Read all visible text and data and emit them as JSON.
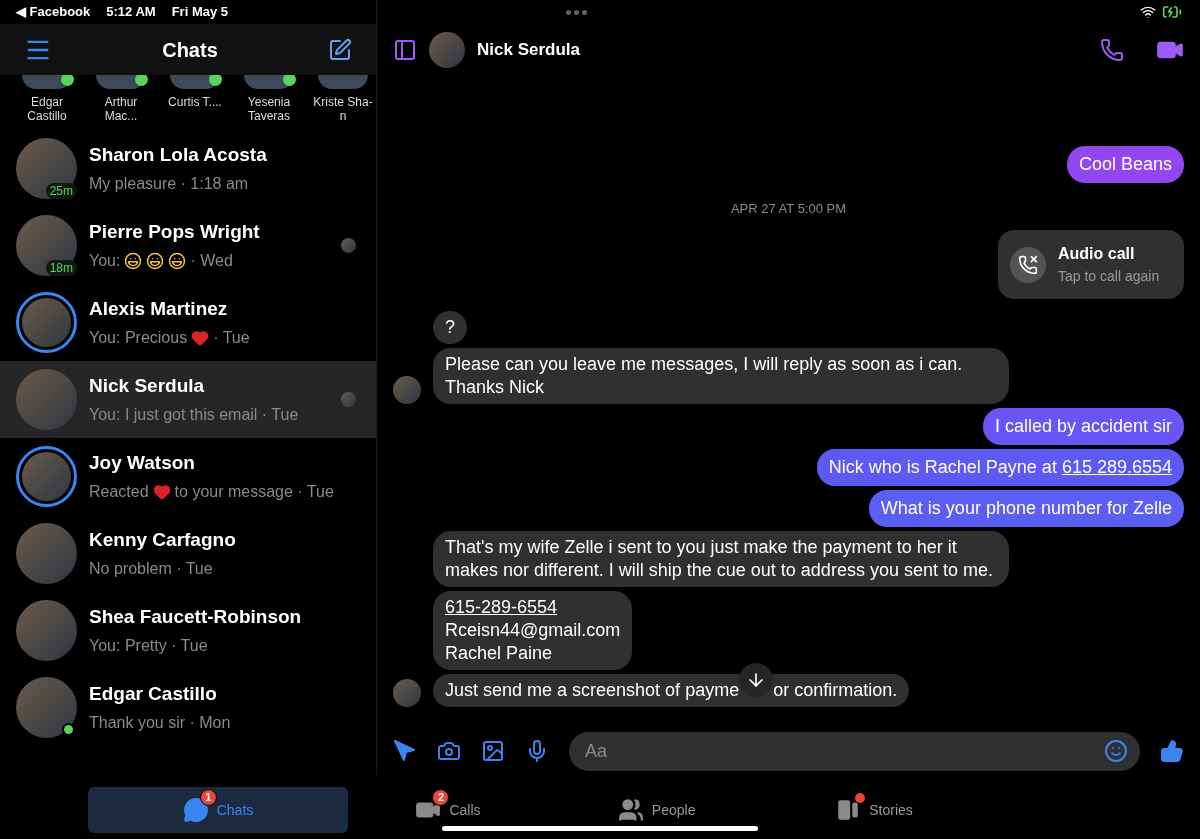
{
  "status_bar": {
    "back_app": "◀ Facebook",
    "time": "5:12 AM",
    "date": "Fri May 5"
  },
  "sidebar": {
    "title": "Chats",
    "active_people": [
      {
        "name": "Edgar Castillo",
        "online": true
      },
      {
        "name": "Arthur Mac...",
        "online": true
      },
      {
        "name": "Curtis T....",
        "online": true
      },
      {
        "name": "Yesenia Taveras",
        "online": true
      },
      {
        "name": "Kriste Sha-n",
        "online": false
      }
    ],
    "chats": [
      {
        "name": "Sharon Lola Acosta",
        "preview": [
          {
            "kind": "text",
            "text": "My pleasure · 1:18 am"
          }
        ],
        "active_ago": "25m",
        "story_ring": false,
        "online": false,
        "seen": false,
        "selected": false
      },
      {
        "name": "Pierre Pops Wright",
        "preview": [
          {
            "kind": "text",
            "text": "You:"
          },
          {
            "kind": "laugh"
          },
          {
            "kind": "laugh"
          },
          {
            "kind": "laugh"
          },
          {
            "kind": "text",
            "text": "· Wed"
          }
        ],
        "active_ago": "18m",
        "story_ring": false,
        "online": false,
        "seen": true,
        "selected": false
      },
      {
        "name": "Alexis Martinez",
        "preview": [
          {
            "kind": "text",
            "text": "You: Precious"
          },
          {
            "kind": "heart"
          },
          {
            "kind": "text",
            "text": "· Tue"
          }
        ],
        "story_ring": true,
        "online": false,
        "seen": false,
        "selected": false
      },
      {
        "name": "Nick Serdula",
        "preview": [
          {
            "kind": "text",
            "text": "You: I just got this email · Tue"
          }
        ],
        "story_ring": false,
        "online": false,
        "seen": true,
        "selected": true
      },
      {
        "name": "Joy Watson",
        "preview": [
          {
            "kind": "text",
            "text": "Reacted"
          },
          {
            "kind": "heart"
          },
          {
            "kind": "text",
            "text": "to your message  · Tue"
          }
        ],
        "story_ring": true,
        "online": false,
        "seen": false,
        "selected": false
      },
      {
        "name": "Kenny Carfagno",
        "preview": [
          {
            "kind": "text",
            "text": "No problem · Tue"
          }
        ],
        "story_ring": false,
        "online": false,
        "seen": false,
        "selected": false
      },
      {
        "name": "Shea Faucett-Robinson",
        "preview": [
          {
            "kind": "text",
            "text": "You: Pretty · Tue"
          }
        ],
        "story_ring": false,
        "online": false,
        "seen": false,
        "selected": false
      },
      {
        "name": "Edgar Castillo",
        "preview": [
          {
            "kind": "text",
            "text": "Thank you sir · Mon"
          }
        ],
        "story_ring": false,
        "online": true,
        "seen": false,
        "selected": false
      }
    ]
  },
  "conversation": {
    "title": "Nick Serdula",
    "messages": [
      {
        "kind": "out",
        "color": "#9146ef",
        "parts": [
          {
            "text": "Cool Beans"
          }
        ]
      },
      {
        "kind": "date",
        "text": "APR 27 AT 5:00 PM"
      },
      {
        "kind": "call",
        "title": "Audio call",
        "subtitle": "Tap to call again"
      },
      {
        "kind": "in",
        "avatar": false,
        "parts": [
          {
            "text": "?"
          }
        ]
      },
      {
        "kind": "in",
        "avatar": true,
        "parts": [
          {
            "text": "Please can you leave me messages, I will reply as soon as i can. Thanks Nick"
          }
        ]
      },
      {
        "kind": "out",
        "color": "#6a55f4",
        "parts": [
          {
            "text": "I called by accident sir"
          }
        ]
      },
      {
        "kind": "out",
        "color": "#5c5af3",
        "parts": [
          {
            "text": "Nick who is Rachel Payne at "
          },
          {
            "text": "615 289.6554",
            "link": true
          }
        ]
      },
      {
        "kind": "out",
        "color": "#5a5ef2",
        "parts": [
          {
            "text": "What is your phone number  for Zelle"
          }
        ]
      },
      {
        "kind": "in",
        "avatar": false,
        "parts": [
          {
            "text": "That's my wife Zelle i sent to you just make the payment to her it makes nor different. I will ship the cue out to address you sent to me."
          }
        ]
      },
      {
        "kind": "card",
        "lines": [
          {
            "text": "615-289-6554",
            "link": true
          },
          {
            "text": "Rceisn44@gmail.com"
          },
          {
            "text": "Rachel Paine"
          }
        ]
      },
      {
        "kind": "in",
        "avatar": true,
        "parts": [
          {
            "text": "Just send me a screenshot of payme",
            "scroll_button": true
          },
          {
            "text": "or confirmation."
          }
        ]
      }
    ],
    "composer": {
      "placeholder": "Aa"
    }
  },
  "tab_bar": [
    {
      "label": "Chats",
      "selected": true,
      "badge": "1",
      "dot": false
    },
    {
      "label": "Calls",
      "selected": false,
      "badge": "2",
      "dot": false
    },
    {
      "label": "People",
      "selected": false,
      "dot": false
    },
    {
      "label": "Stories",
      "selected": false,
      "dot": true
    }
  ]
}
